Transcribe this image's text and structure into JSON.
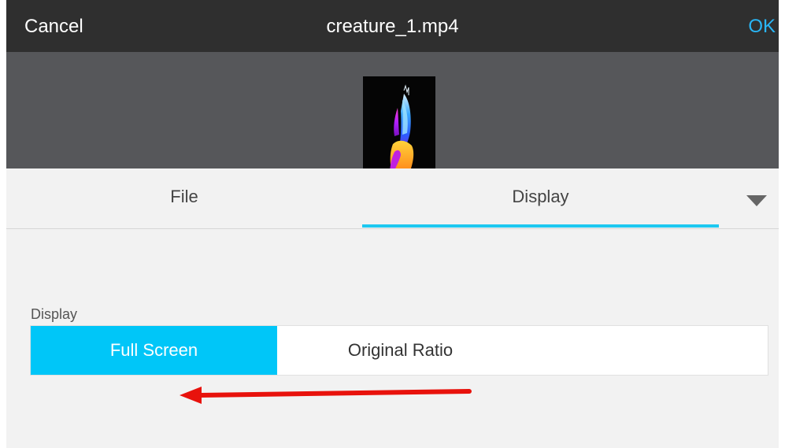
{
  "header": {
    "cancel_label": "Cancel",
    "title": "creature_1.mp4",
    "ok_label": "OK"
  },
  "tabs": [
    {
      "label": "File",
      "selected": false
    },
    {
      "label": "Display",
      "selected": true
    }
  ],
  "display_section": {
    "label": "Display",
    "options": [
      {
        "label": "Full Screen",
        "selected": true
      },
      {
        "label": "Original Ratio",
        "selected": false
      }
    ]
  },
  "colors": {
    "accent": "#00c6f8",
    "ok_text": "#29b6f6",
    "topbar": "#2f2f2f",
    "annotation_arrow": "#e8120c"
  },
  "icons": {
    "dropdown": "triangle-down-icon",
    "annotation": "red-left-arrow"
  }
}
